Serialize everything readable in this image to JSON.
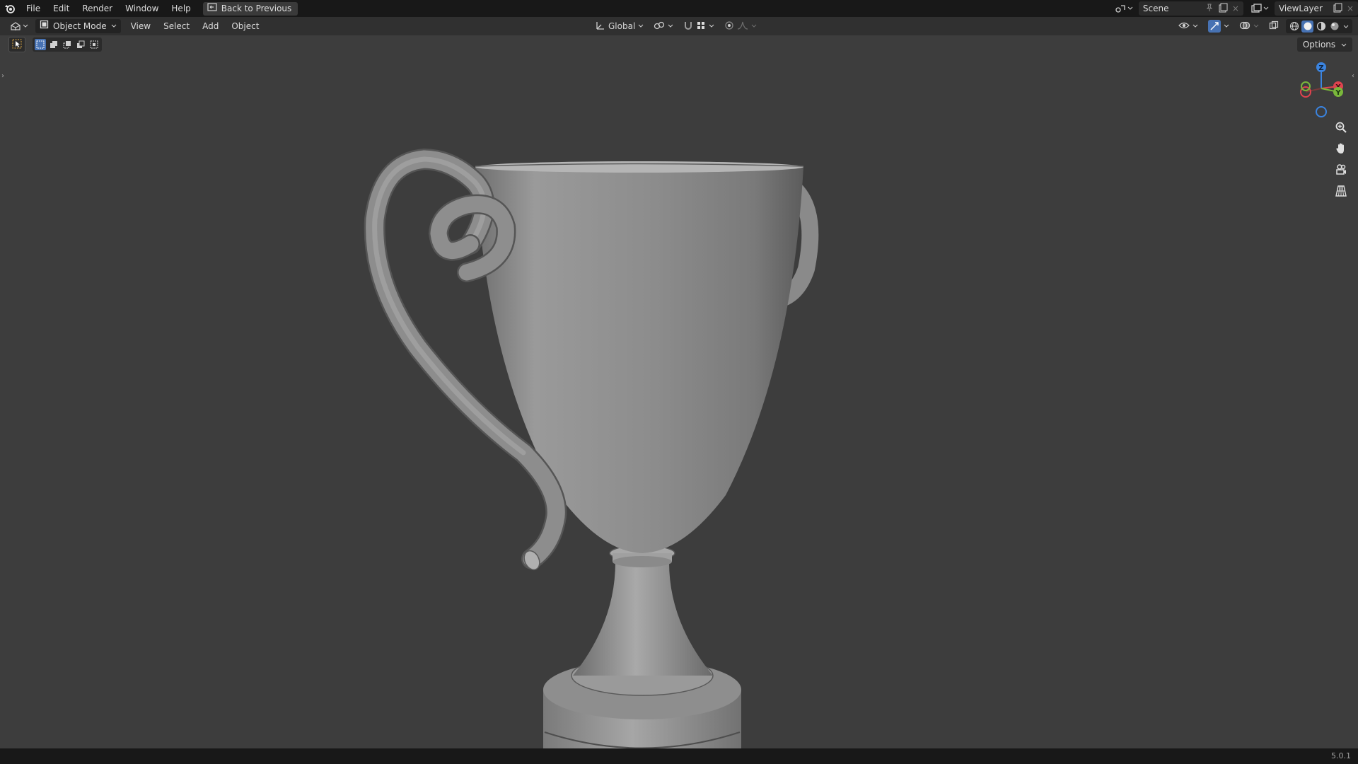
{
  "menu": {
    "items": [
      "File",
      "Edit",
      "Render",
      "Window",
      "Help"
    ],
    "back_button": "Back to Previous"
  },
  "top_right": {
    "scene": "Scene",
    "view_layer": "ViewLayer"
  },
  "header": {
    "mode": "Object Mode",
    "menus": [
      "View",
      "Select",
      "Add",
      "Object"
    ],
    "transform_orientation": "Global"
  },
  "viewport": {
    "options_label": "Options",
    "gizmo_axes": [
      "Z",
      "X",
      "Y"
    ],
    "axis_colors": {
      "x": "#e0434f",
      "y": "#7ab83b",
      "z": "#3b84e0"
    }
  },
  "status": {
    "version": "5.0.1"
  },
  "icons": [
    "blender-logo-icon",
    "back-icon",
    "editor-type-icon",
    "object-mode-icon",
    "orientation-icon",
    "pivot-icon",
    "snap-icon",
    "proportional-icon",
    "visibility-icon",
    "gizmo-icon",
    "overlay-icon",
    "xray-icon",
    "wireframe-icon",
    "solid-icon",
    "material-icon",
    "rendered-icon",
    "zoom-icon",
    "hand-icon",
    "camera-icon",
    "grid-icon",
    "select-tool-icon"
  ]
}
